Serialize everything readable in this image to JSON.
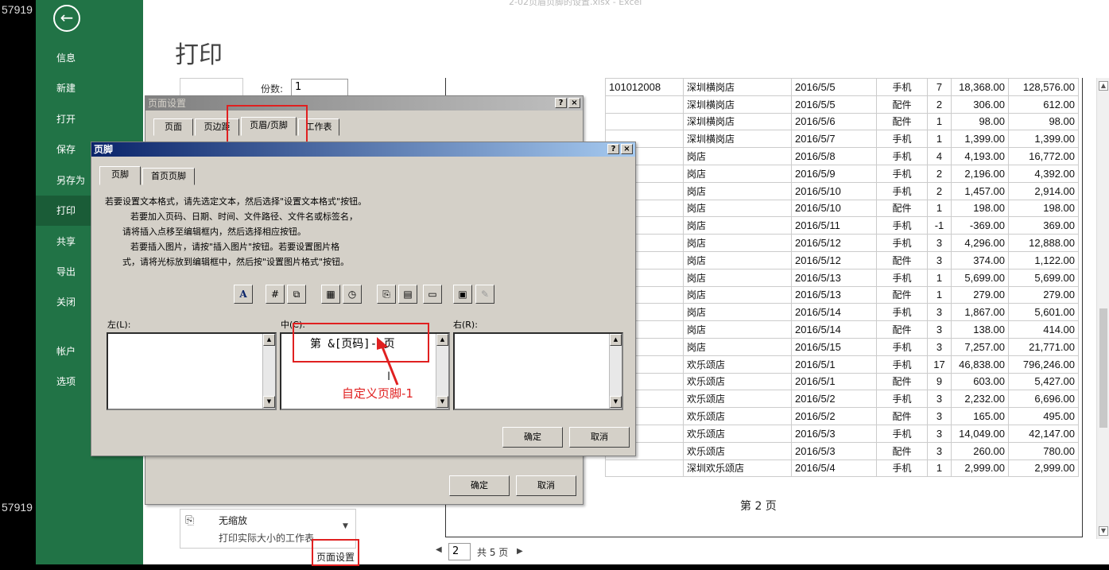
{
  "side_numbers": [
    "57919",
    "57919"
  ],
  "window_title": "2-02页眉页脚的设置.xlsx - Excel",
  "backstage": {
    "back_icon": "arrow-left-icon",
    "items": [
      {
        "label": "信息"
      },
      {
        "label": "新建"
      },
      {
        "label": "打开"
      },
      {
        "label": "保存"
      },
      {
        "label": "另存为"
      },
      {
        "label": "打印"
      },
      {
        "label": "共享"
      },
      {
        "label": "导出"
      },
      {
        "label": "关闭"
      },
      {
        "label": "帐户"
      },
      {
        "label": "选项"
      }
    ],
    "active": "打印"
  },
  "print": {
    "title": "打印",
    "copies_label": "份数:",
    "copies_value": "1",
    "scaling_label": "无缩放",
    "scaling_desc": "打印实际大小的工作表",
    "page_setup_link": "页面设置",
    "pager_current": "2",
    "pager_total": "共 5 页"
  },
  "preview": {
    "rows": [
      [
        "101012008",
        "深圳横岗店",
        "2016/5/5",
        "手机",
        "7",
        "18,368.00",
        "128,576.00"
      ],
      [
        "",
        "深圳横岗店",
        "2016/5/5",
        "配件",
        "2",
        "306.00",
        "612.00"
      ],
      [
        "",
        "深圳横岗店",
        "2016/5/6",
        "配件",
        "1",
        "98.00",
        "98.00"
      ],
      [
        "",
        "深圳横岗店",
        "2016/5/7",
        "手机",
        "1",
        "1,399.00",
        "1,399.00"
      ],
      [
        "",
        "岗店",
        "2016/5/8",
        "手机",
        "4",
        "4,193.00",
        "16,772.00"
      ],
      [
        "",
        "岗店",
        "2016/5/9",
        "手机",
        "2",
        "2,196.00",
        "4,392.00"
      ],
      [
        "",
        "岗店",
        "2016/5/10",
        "手机",
        "2",
        "1,457.00",
        "2,914.00"
      ],
      [
        "",
        "岗店",
        "2016/5/10",
        "配件",
        "1",
        "198.00",
        "198.00"
      ],
      [
        "",
        "岗店",
        "2016/5/11",
        "手机",
        "-1",
        "-369.00",
        "369.00"
      ],
      [
        "",
        "岗店",
        "2016/5/12",
        "手机",
        "3",
        "4,296.00",
        "12,888.00"
      ],
      [
        "",
        "岗店",
        "2016/5/12",
        "配件",
        "3",
        "374.00",
        "1,122.00"
      ],
      [
        "",
        "岗店",
        "2016/5/13",
        "手机",
        "1",
        "5,699.00",
        "5,699.00"
      ],
      [
        "",
        "岗店",
        "2016/5/13",
        "配件",
        "1",
        "279.00",
        "279.00"
      ],
      [
        "",
        "岗店",
        "2016/5/14",
        "手机",
        "3",
        "1,867.00",
        "5,601.00"
      ],
      [
        "",
        "岗店",
        "2016/5/14",
        "配件",
        "3",
        "138.00",
        "414.00"
      ],
      [
        "",
        "岗店",
        "2016/5/15",
        "手机",
        "3",
        "7,257.00",
        "21,771.00"
      ],
      [
        "",
        "欢乐颂店",
        "2016/5/1",
        "手机",
        "17",
        "46,838.00",
        "796,246.00"
      ],
      [
        "",
        "欢乐颂店",
        "2016/5/1",
        "配件",
        "9",
        "603.00",
        "5,427.00"
      ],
      [
        "",
        "欢乐颂店",
        "2016/5/2",
        "手机",
        "3",
        "2,232.00",
        "6,696.00"
      ],
      [
        "",
        "欢乐颂店",
        "2016/5/2",
        "配件",
        "3",
        "165.00",
        "495.00"
      ],
      [
        "",
        "欢乐颂店",
        "2016/5/3",
        "手机",
        "3",
        "14,049.00",
        "42,147.00"
      ],
      [
        "",
        "欢乐颂店",
        "2016/5/3",
        "配件",
        "3",
        "260.00",
        "780.00"
      ],
      [
        "",
        "深圳欢乐颂店",
        "2016/5/4",
        "手机",
        "1",
        "2,999.00",
        "2,999.00"
      ]
    ],
    "footer_text": "第 2 页"
  },
  "page_setup_dialog": {
    "title": "页面设置",
    "tabs": [
      "页面",
      "页边距",
      "页眉/页脚",
      "工作表"
    ],
    "selected_tab": "页眉/页脚",
    "ok": "确定",
    "cancel": "取消"
  },
  "footer_dialog": {
    "title": "页脚",
    "tabs": [
      "页脚",
      "首页页脚"
    ],
    "instructions": [
      "若要设置文本格式，请先选定文本，然后选择\"设置文本格式\"按钮。",
      "若要加入页码、日期、时间、文件路径、文件名或标签名，",
      "请将插入点移至编辑框内，然后选择相应按钮。",
      "若要插入图片，请按\"插入图片\"按钮。若要设置图片格",
      "式，请将光标放到编辑框中，然后按\"设置图片格式\"按钮。"
    ],
    "toolbar_icons": [
      "format-text-icon",
      "page-number-icon",
      "page-count-icon",
      "date-icon",
      "time-icon",
      "file-path-icon",
      "file-name-icon",
      "sheet-name-icon",
      "insert-picture-icon",
      "format-picture-icon"
    ],
    "left_label": "左(L):",
    "center_label": "中(C):",
    "right_label": "右(R):",
    "center_value": "第 &[页码]- 页",
    "ok": "确定",
    "cancel": "取消"
  },
  "annotation": {
    "text": "自定义页脚-1",
    "color": "#e02020"
  }
}
